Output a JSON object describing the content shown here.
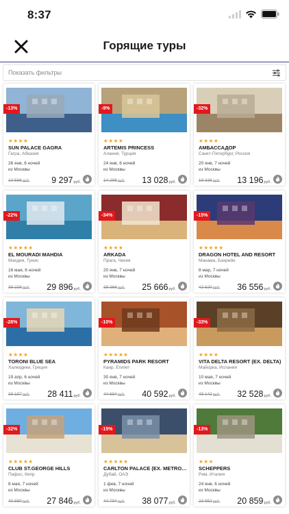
{
  "status_bar": {
    "time": "8:37"
  },
  "header": {
    "title": "Горящие туры",
    "close_icon": "close-x-icon"
  },
  "filters": {
    "placeholder": "Показать фильтры",
    "icon": "sliders-icon"
  },
  "currency": "руб.",
  "colors": {
    "accent_line": "#3b3a8a",
    "discount_badge": "#e2181d",
    "stars": "#f3a21b"
  },
  "tours": [
    {
      "discount": "-13%",
      "stars": 4,
      "name": "SUN PALACE GAGRA",
      "location": "Гагра, Абхазия",
      "dates": "26 янв, 6 ночей",
      "departure": "из Москвы",
      "old_price": "10 586",
      "price": "9 297"
    },
    {
      "discount": "-9%",
      "stars": 4,
      "name": "ARTEMIS PRINCESS",
      "location": "Алания, Турция",
      "dates": "24 янв, 6 ночей",
      "departure": "из Москвы",
      "old_price": "14 298",
      "price": "13 028"
    },
    {
      "discount": "-32%",
      "stars": 4,
      "name": "АМБАССАДОР",
      "location": "Санкт-Петербург, Россия",
      "dates": "20 янв, 7 ночей",
      "departure": "из Москвы",
      "old_price": "19 336",
      "price": "13 196"
    },
    {
      "discount": "-22%",
      "stars": 5,
      "name": "EL MOURADI MAHDIA",
      "location": "Махдия, Тунис",
      "dates": "16 мая, 6 ночей",
      "departure": "из Москвы",
      "old_price": "38 228",
      "price": "29 896"
    },
    {
      "discount": "-34%",
      "stars": 4,
      "name": "ARKADA",
      "location": "Прага, Чехия",
      "dates": "20 янв, 7 ночей",
      "departure": "из Москвы",
      "old_price": "38 366",
      "price": "25 666"
    },
    {
      "discount": "-15%",
      "stars": 5,
      "name": "DRAGON HOTEL AND RESORT",
      "location": "Манама, Бахрейн",
      "dates": "8 мар, 7 ночей",
      "departure": "из Москвы",
      "old_price": "42 620",
      "price": "36 556"
    },
    {
      "discount": "-28%",
      "stars": 4,
      "name": "TORONI BLUE SEA",
      "location": "Халкидики, Греция",
      "dates": "19 апр, 6 ночей",
      "departure": "из Москвы",
      "old_price": "39 197",
      "price": "28 411"
    },
    {
      "discount": "-10%",
      "stars": 5,
      "name": "PYRAMIDS PARK RESORT",
      "location": "Каир, Египет",
      "dates": "30 янв, 7 ночей",
      "departure": "из Москвы",
      "old_price": "44 684",
      "price": "40 592"
    },
    {
      "discount": "-33%",
      "stars": 4,
      "name": "VITA DELTA RESORT (EX. DELTA)",
      "location": "Майорка, Испания",
      "dates": "10 мая, 7 ночей",
      "departure": "из Москвы",
      "old_price": "48 142",
      "price": "32 528"
    },
    {
      "discount": "-32%",
      "stars": 5,
      "name": "CLUB ST.GEORGE HILLS",
      "location": "Пафос, Кипр",
      "dates": "8 мая, 7 ночей",
      "departure": "из Москвы",
      "old_price": "40 880",
      "price": "27 846"
    },
    {
      "discount": "-15%",
      "stars": 5,
      "name": "CARLTON PALACE (EX. METROPOLI...",
      "location": "Дубай, ОАЭ",
      "dates": "1 фев, 7 ночей",
      "departure": "из Москвы",
      "old_price": "44 794",
      "price": "38 077"
    },
    {
      "discount": "-13%",
      "stars": 3,
      "name": "SCHEPPERS",
      "location": "Рим, Италия",
      "dates": "24 янв, 6 ночей",
      "departure": "из Москвы",
      "old_price": "23 952",
      "price": "20 859"
    }
  ]
}
